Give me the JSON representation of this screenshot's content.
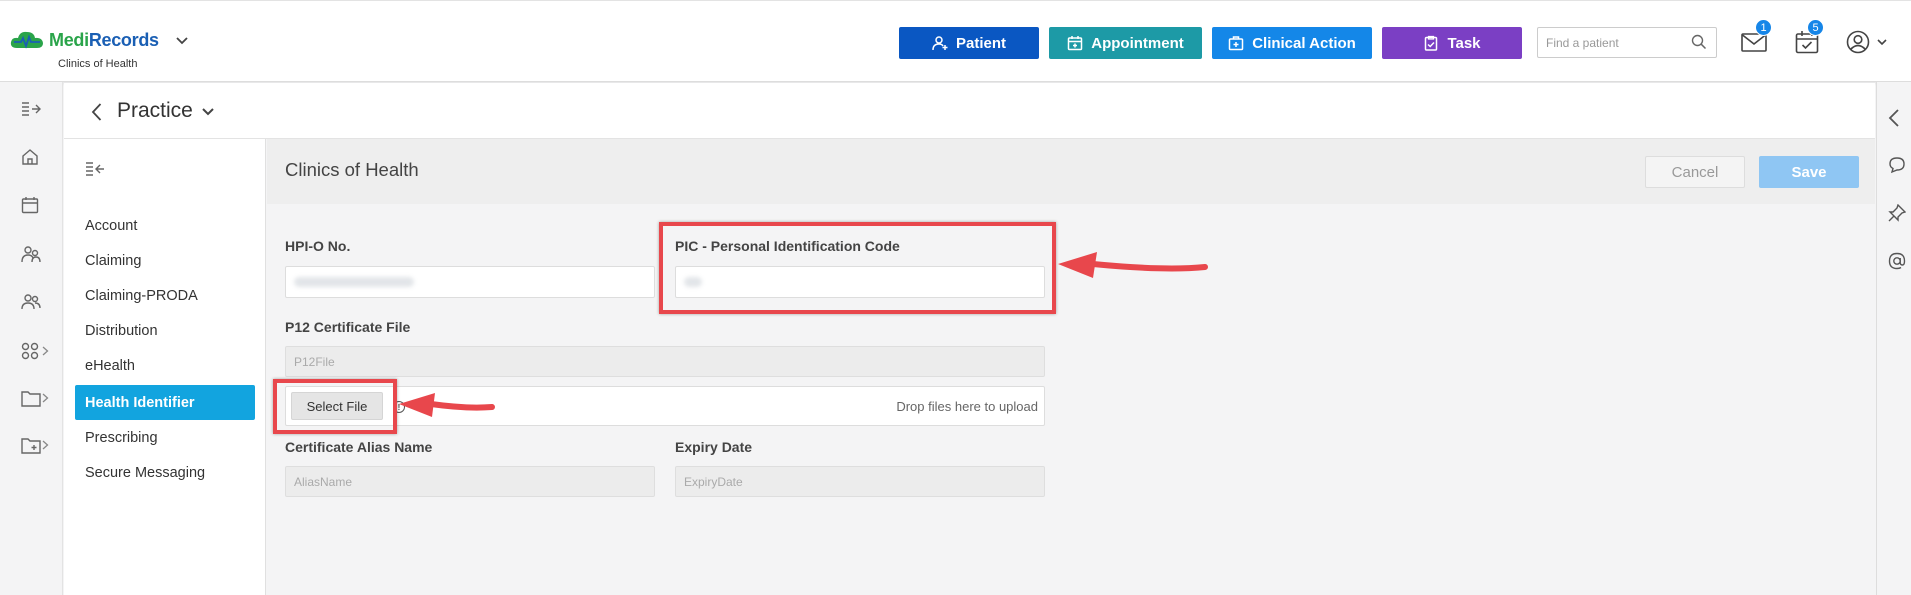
{
  "brand": {
    "name_part1": "Medi",
    "name_part2": "Records",
    "practice_name": "Clinics of Health"
  },
  "topbar": {
    "buttons": [
      {
        "label": "Patient",
        "color": "#0a57c2"
      },
      {
        "label": "Appointment",
        "color": "#1d9aa6"
      },
      {
        "label": "Clinical Action",
        "color": "#1487e8"
      },
      {
        "label": "Task",
        "color": "#7b3fc4"
      }
    ],
    "search_placeholder": "Find a patient",
    "mail_badge": "1",
    "tasks_badge": "5"
  },
  "practice_bar": {
    "title": "Practice"
  },
  "submenu": {
    "items": [
      "Account",
      "Claiming",
      "Claiming-PRODA",
      "Distribution",
      "eHealth",
      "Health Identifier",
      "Prescribing",
      "Secure Messaging"
    ],
    "active_index": 5
  },
  "content": {
    "title": "Clinics of Health",
    "cancel_label": "Cancel",
    "save_label": "Save",
    "fields": {
      "hpio_label": "HPI-O No.",
      "pic_label": "PIC - Personal Identification Code",
      "p12_label": "P12 Certificate File",
      "p12_placeholder": "P12File",
      "select_file_label": "Select File",
      "drop_text": "Drop files here to upload",
      "alias_label": "Certificate Alias Name",
      "alias_placeholder": "AliasName",
      "expiry_label": "Expiry Date",
      "expiry_placeholder": "ExpiryDate"
    }
  },
  "colors": {
    "accent": "#12a4df",
    "highlight": "#e8474c"
  }
}
